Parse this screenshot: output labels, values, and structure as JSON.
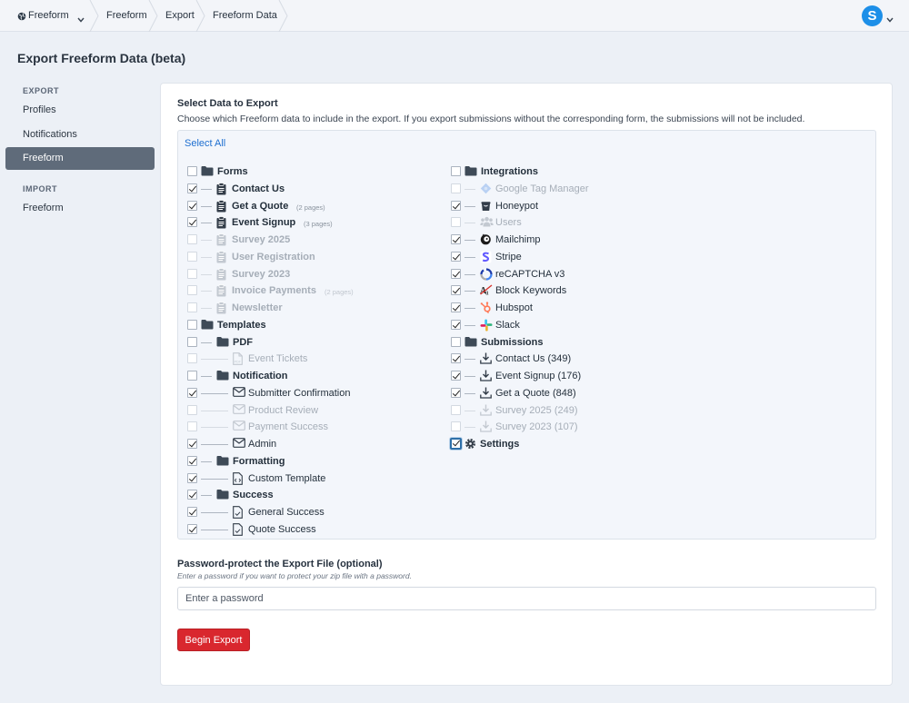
{
  "breadcrumb": [
    "Freeform",
    "Freeform",
    "Export",
    "Freeform Data"
  ],
  "avatar_letter": "S",
  "page_title": "Export Freeform Data (beta)",
  "sidebar": {
    "export_heading": "EXPORT",
    "export_items": [
      "Profiles",
      "Notifications",
      "Freeform"
    ],
    "import_heading": "IMPORT",
    "import_items": [
      "Freeform"
    ],
    "active": "Freeform"
  },
  "select_section": {
    "title": "Select Data to Export",
    "description": "Choose which Freeform data to include in the export. If you export submissions without the corresponding form, the submissions will not be included.",
    "select_all": "Select All"
  },
  "tree_left": [
    {
      "label": "Forms",
      "level": 0,
      "icon": "folder-icon",
      "checked": false,
      "bold": true,
      "dim": false
    },
    {
      "label": "Contact Us",
      "level": 1,
      "icon": "clipboard-icon",
      "checked": true,
      "bold": true,
      "dim": false
    },
    {
      "label": "Get a Quote",
      "level": 1,
      "icon": "clipboard-icon",
      "checked": true,
      "bold": true,
      "dim": false,
      "pages": "(2 pages)"
    },
    {
      "label": "Event Signup",
      "level": 1,
      "icon": "clipboard-icon",
      "checked": true,
      "bold": true,
      "dim": false,
      "pages": "(3 pages)"
    },
    {
      "label": "Survey 2025",
      "level": 1,
      "icon": "clipboard-icon",
      "checked": false,
      "bold": true,
      "dim": true
    },
    {
      "label": "User Registration",
      "level": 1,
      "icon": "clipboard-icon",
      "checked": false,
      "bold": true,
      "dim": true
    },
    {
      "label": "Survey 2023",
      "level": 1,
      "icon": "clipboard-icon",
      "checked": false,
      "bold": true,
      "dim": true
    },
    {
      "label": "Invoice Payments",
      "level": 1,
      "icon": "clipboard-icon",
      "checked": false,
      "bold": true,
      "dim": true,
      "pages": "(2 pages)"
    },
    {
      "label": "Newsletter",
      "level": 1,
      "icon": "clipboard-icon",
      "checked": false,
      "bold": true,
      "dim": true
    },
    {
      "label": "Templates",
      "level": 0,
      "icon": "folder-icon",
      "checked": false,
      "bold": true,
      "dim": false
    },
    {
      "label": "PDF",
      "level": 1,
      "icon": "folder-icon",
      "checked": false,
      "bold": true,
      "dim": false
    },
    {
      "label": "Event Tickets",
      "level": 2,
      "icon": "pdf-file-icon",
      "checked": false,
      "bold": false,
      "dim": true
    },
    {
      "label": "Notification",
      "level": 1,
      "icon": "folder-icon",
      "checked": false,
      "bold": true,
      "dim": false
    },
    {
      "label": "Submitter Confirmation",
      "level": 2,
      "icon": "envelope-icon",
      "checked": true,
      "bold": false,
      "dim": false
    },
    {
      "label": "Product Review",
      "level": 2,
      "icon": "envelope-icon",
      "checked": false,
      "bold": false,
      "dim": true
    },
    {
      "label": "Payment Success",
      "level": 2,
      "icon": "envelope-icon",
      "checked": false,
      "bold": false,
      "dim": true
    },
    {
      "label": "Admin",
      "level": 2,
      "icon": "envelope-icon",
      "checked": true,
      "bold": false,
      "dim": false
    },
    {
      "label": "Formatting",
      "level": 1,
      "icon": "folder-icon",
      "checked": true,
      "bold": true,
      "dim": false
    },
    {
      "label": "Custom Template",
      "level": 2,
      "icon": "code-file-icon",
      "checked": true,
      "bold": false,
      "dim": false
    },
    {
      "label": "Success",
      "level": 1,
      "icon": "folder-icon",
      "checked": true,
      "bold": true,
      "dim": false
    },
    {
      "label": "General Success",
      "level": 2,
      "icon": "check-file-icon",
      "checked": true,
      "bold": false,
      "dim": false
    },
    {
      "label": "Quote Success",
      "level": 2,
      "icon": "check-file-icon",
      "checked": true,
      "bold": false,
      "dim": false
    }
  ],
  "tree_right": [
    {
      "label": "Integrations",
      "level": 0,
      "icon": "folder-icon",
      "checked": false,
      "bold": true,
      "dim": false
    },
    {
      "label": "Google Tag Manager",
      "level": 1,
      "icon": "google-tag-manager-icon",
      "checked": false,
      "bold": false,
      "dim": true
    },
    {
      "label": "Honeypot",
      "level": 1,
      "icon": "honeypot-icon",
      "checked": true,
      "bold": false,
      "dim": false
    },
    {
      "label": "Users",
      "level": 1,
      "icon": "users-icon",
      "checked": false,
      "bold": false,
      "dim": true
    },
    {
      "label": "Mailchimp",
      "level": 1,
      "icon": "mailchimp-icon",
      "checked": true,
      "bold": false,
      "dim": false
    },
    {
      "label": "Stripe",
      "level": 1,
      "icon": "stripe-icon",
      "checked": true,
      "bold": false,
      "dim": false
    },
    {
      "label": "reCAPTCHA v3",
      "level": 1,
      "icon": "recaptcha-icon",
      "checked": true,
      "bold": false,
      "dim": false
    },
    {
      "label": "Block Keywords",
      "level": 1,
      "icon": "block-keywords-icon",
      "checked": true,
      "bold": false,
      "dim": false
    },
    {
      "label": "Hubspot",
      "level": 1,
      "icon": "hubspot-icon",
      "checked": true,
      "bold": false,
      "dim": false
    },
    {
      "label": "Slack",
      "level": 1,
      "icon": "slack-icon",
      "checked": true,
      "bold": false,
      "dim": false
    },
    {
      "label": "Submissions",
      "level": 0,
      "icon": "folder-icon",
      "checked": false,
      "bold": true,
      "dim": false
    },
    {
      "label": "Contact Us (349)",
      "level": 1,
      "icon": "download-icon",
      "checked": true,
      "bold": false,
      "dim": false
    },
    {
      "label": "Event Signup (176)",
      "level": 1,
      "icon": "download-icon",
      "checked": true,
      "bold": false,
      "dim": false
    },
    {
      "label": "Get a Quote (848)",
      "level": 1,
      "icon": "download-icon",
      "checked": true,
      "bold": false,
      "dim": false
    },
    {
      "label": "Survey 2025 (249)",
      "level": 1,
      "icon": "download-icon",
      "checked": false,
      "bold": false,
      "dim": true
    },
    {
      "label": "Survey 2023 (107)",
      "level": 1,
      "icon": "download-icon",
      "checked": false,
      "bold": false,
      "dim": true
    },
    {
      "label": "Settings",
      "level": 0,
      "icon": "gear-icon",
      "checked": true,
      "bold": true,
      "dim": false,
      "focused": true
    }
  ],
  "password_section": {
    "title": "Password-protect the Export File (optional)",
    "hint": "Enter a password if you want to protect your zip file with a password.",
    "placeholder": "Enter a password"
  },
  "begin_export_label": "Begin Export"
}
